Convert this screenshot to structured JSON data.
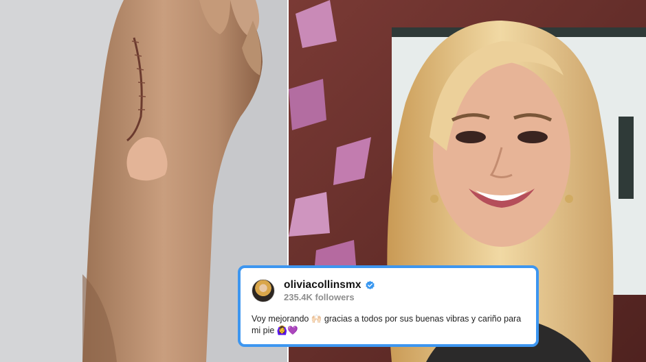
{
  "post": {
    "username": "oliviacollinsmx",
    "followers": "235.4K followers",
    "caption": "Voy mejorando 🙌🏻 gracias a todos por sus buenas vibras y cariño para mi pie 🙆‍♀️💜"
  },
  "colors": {
    "card_border": "#3d96f0",
    "verified_badge": "#3897f0",
    "followers_text": "#8e8e8e"
  },
  "icons": {
    "verified": "verified-badge-icon"
  }
}
